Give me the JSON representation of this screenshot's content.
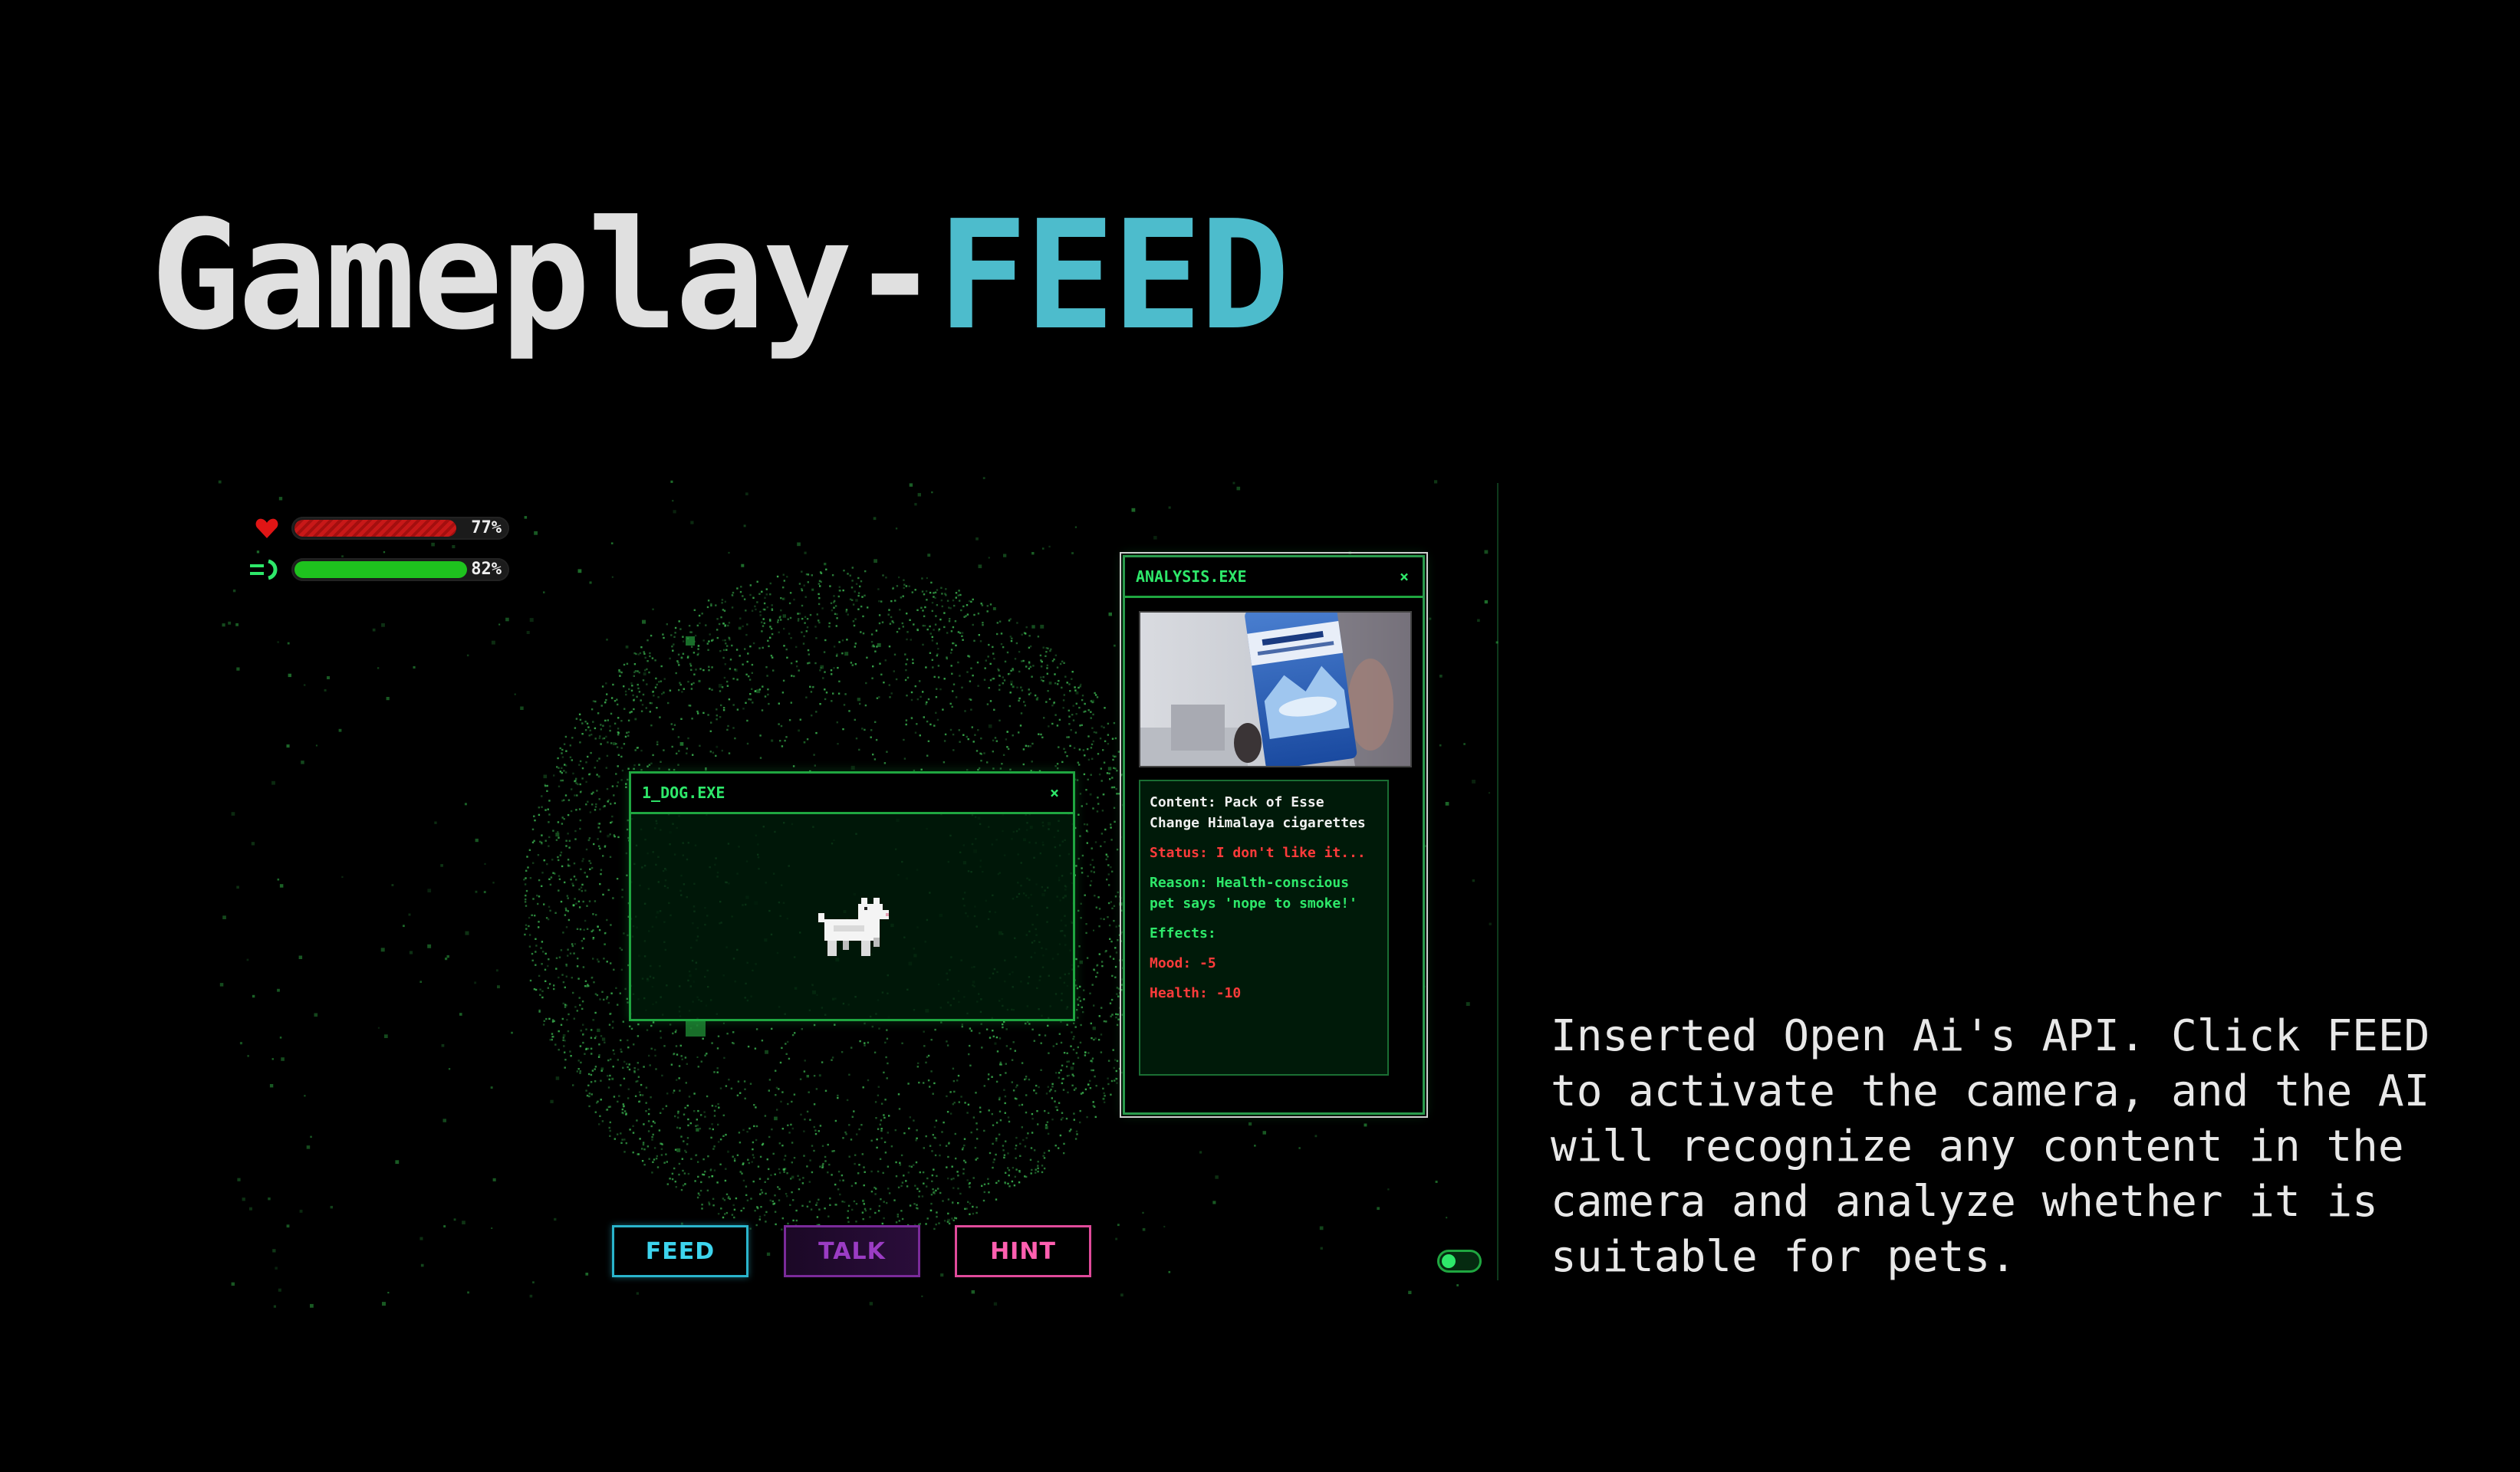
{
  "slide": {
    "title_main": "Gameplay-",
    "title_accent": "FEED",
    "description": "Inserted Open Ai's API. Click FEED to activate the camera, and the AI will recognize any content in the camera and analyze whether it is suitable for pets."
  },
  "game": {
    "stats": [
      {
        "icon": "heart-icon",
        "value_label": "77%",
        "fraction": 0.77,
        "color": "#c81818"
      },
      {
        "icon": "energy-icon",
        "value_label": "82%",
        "fraction": 0.82,
        "color": "#1ec21e"
      }
    ],
    "dog_window": {
      "title": "1_DOG.EXE",
      "close": "×",
      "sprite": "pixel-dog-icon"
    },
    "analysis_window": {
      "title": "ANALYSIS.EXE",
      "close": "×",
      "content": "Content: Pack of Esse Change Himalaya cigarettes",
      "status": "Status: I don't like it...",
      "reason": "Reason: Health-conscious pet says 'nope to smoke!'",
      "effects_label": "Effects:",
      "mood": "Mood: -5",
      "health": "Health: -10"
    },
    "buttons": {
      "feed": "FEED",
      "talk": "TALK",
      "hint": "HINT"
    },
    "colors": {
      "accent": "#4dbccc",
      "terminal_green": "#2ee86a",
      "alert_red": "#ff3b3b"
    }
  }
}
